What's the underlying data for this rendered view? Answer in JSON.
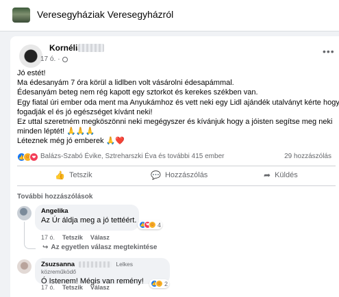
{
  "group": {
    "name": "Veresegyháziak Veresegyházról"
  },
  "post": {
    "author": "Kornélia",
    "time": "17 ó.",
    "body": [
      "Jó estét!",
      "Ma édesanyám 7 óra körül a lidlben volt vásárolni édesapámmal.",
      "Édesanyám beteg nem rég kapott egy sztorkot és kerekes székben van.",
      "Egy fiatal úri ember oda ment ma Anyukámhoz és vett neki egy Lidl ajándék utalványt kérte hogy",
      "fogadják el és jó egészséget kívánt neki!",
      "Ez uttal szeretném megköszönni neki megégyszer és kívánjuk hogy a jóisten segítse meg neki",
      "minden léptét! 🙏🙏🙏",
      "Léteznek még jó emberek 🙏❤️"
    ],
    "reactions_text": "Balázs-Szabó Évike, Sztreharszki Éva és további 415 ember",
    "comments_count": "29 hozzászólás"
  },
  "actions": {
    "like": "Tetszik",
    "comment": "Hozzászólás",
    "send": "Küldés"
  },
  "more_comments": "További hozzászólások",
  "comments": [
    {
      "name": "Angelika",
      "text": "Az Úr áldja meg a jó tettéért.",
      "time": "17 ó.",
      "like": "Tetszik",
      "reply": "Válasz",
      "reaction_count": "4",
      "reply_link": "Az egyetlen válasz megtekintése"
    },
    {
      "name": "Zsuzsanna",
      "badge": "Lelkes közreműködő",
      "text": "Ó Istenem! Mégis van remény!",
      "time": "17 ó.",
      "like": "Tetszik",
      "reply": "Válasz",
      "reaction_count": "2"
    }
  ],
  "icons": {
    "more": "more-icon",
    "globe": "globe-icon",
    "like": "like-icon",
    "comment": "comment-icon",
    "send": "send-icon",
    "reply_arrow": "reply-arrow-icon"
  },
  "colors": {
    "facebook_blue": "#1877f2",
    "love_red": "#f33e58",
    "care_yellow": "#f7b125"
  }
}
